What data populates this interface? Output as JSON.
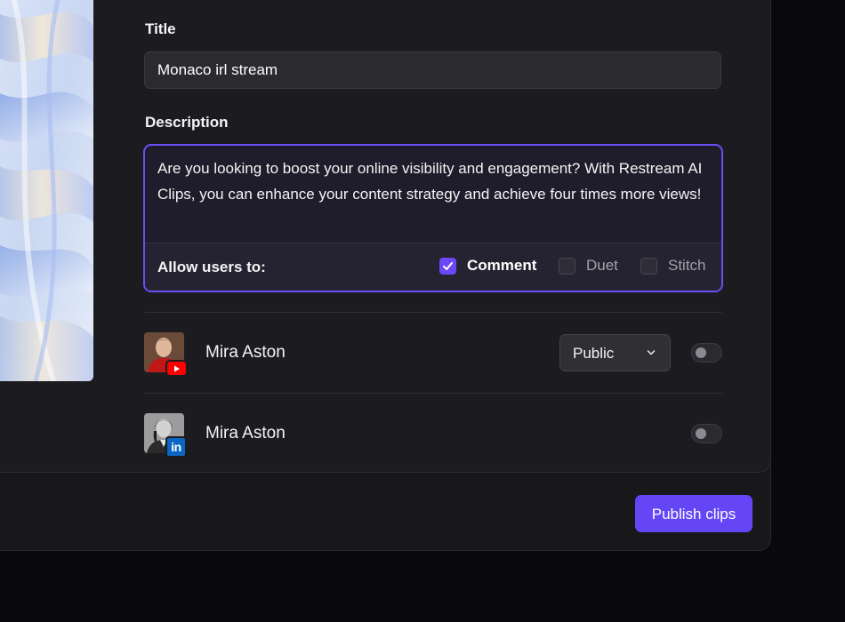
{
  "form": {
    "title_label": "Title",
    "title_value": "Monaco irl stream",
    "description_label": "Description",
    "description_value": "Are you looking to boost your online visibility and engagement? With Restream AI Clips, you can enhance your content strategy and achieve four times more views!"
  },
  "permissions": {
    "label": "Allow users to:",
    "options": [
      {
        "label": "Comment",
        "checked": true
      },
      {
        "label": "Duet",
        "checked": false
      },
      {
        "label": "Stitch",
        "checked": false
      }
    ]
  },
  "accounts": [
    {
      "name": "Mira Aston",
      "platform": "youtube",
      "privacy": "Public",
      "enabled": false
    },
    {
      "name": "Mira Aston",
      "platform": "linkedin",
      "enabled": false
    }
  ],
  "actions": {
    "publish_label": "Publish clips"
  },
  "badges": {
    "linkedin_text": "in"
  },
  "colors": {
    "accent": "#6446f6",
    "focus_border": "#6d4cf5",
    "youtube": "#ff0000",
    "linkedin": "#0a66c2"
  }
}
